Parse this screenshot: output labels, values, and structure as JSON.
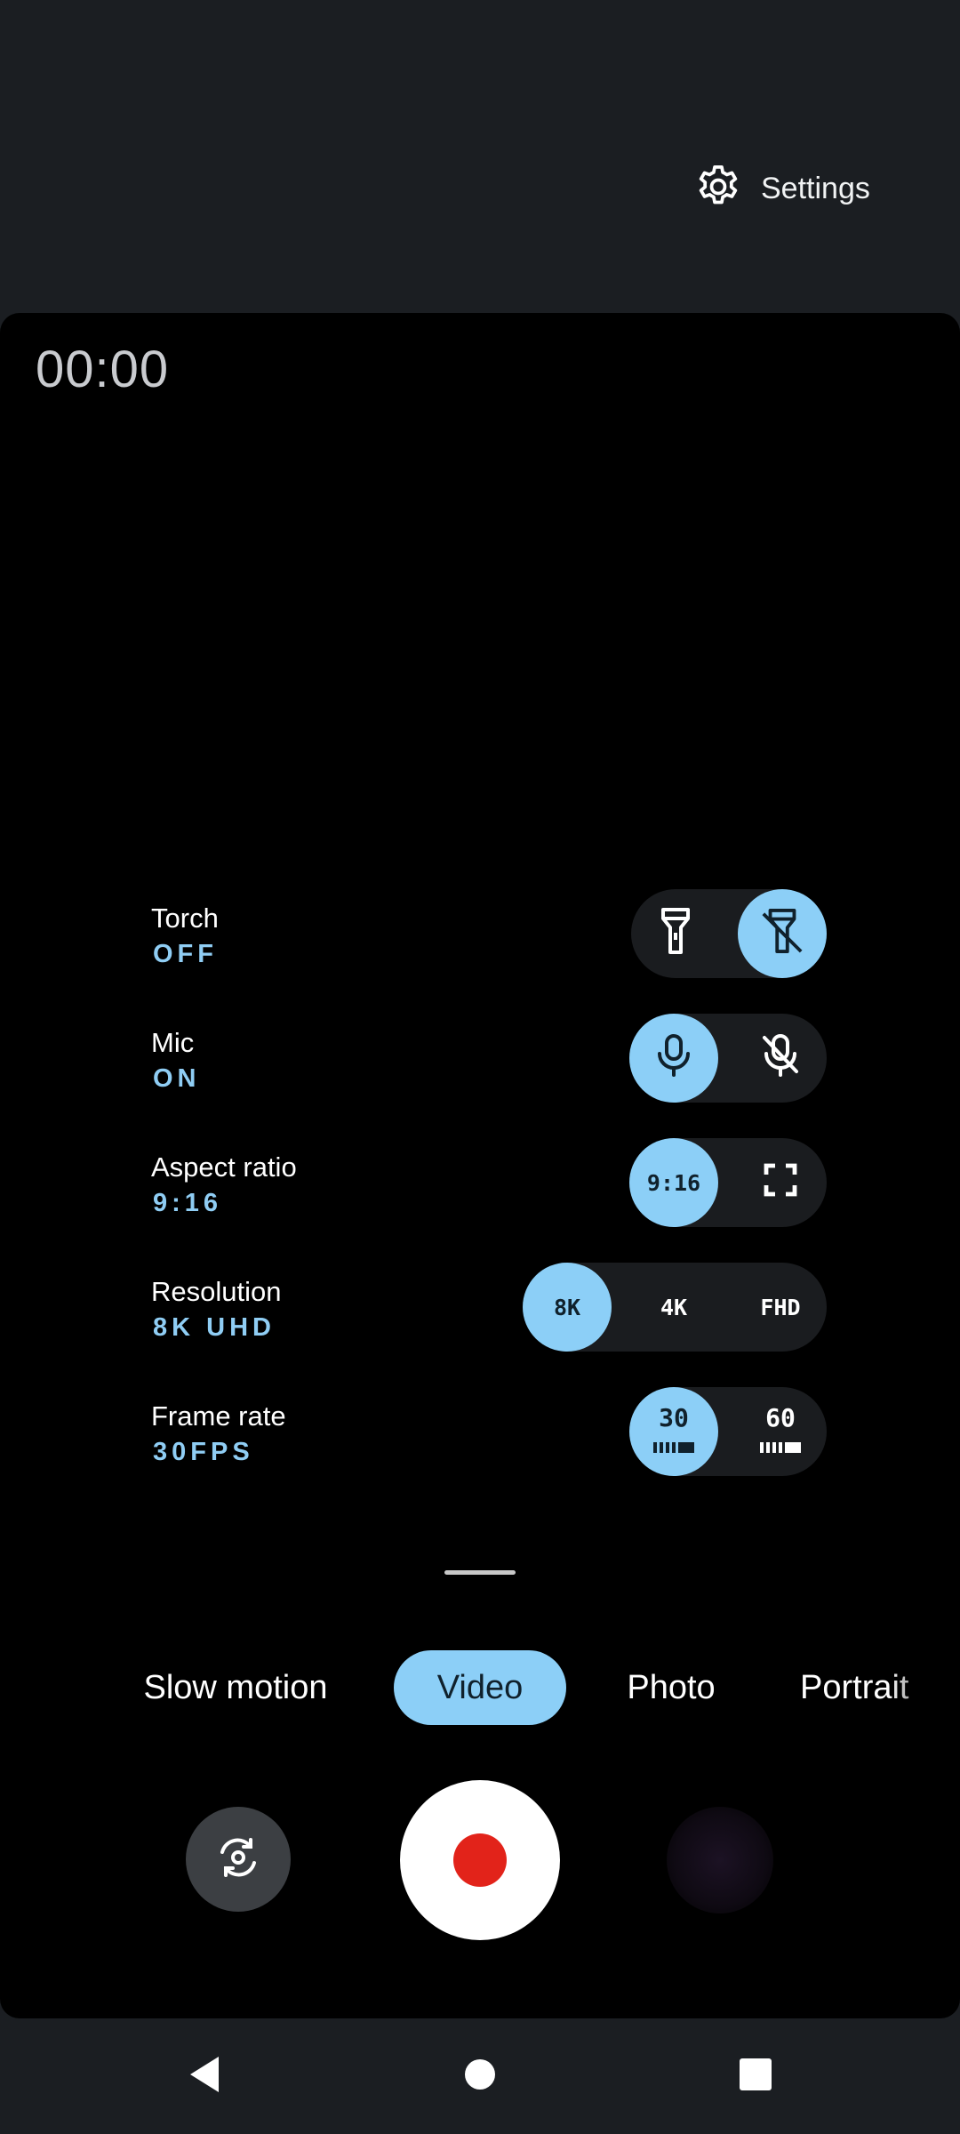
{
  "header": {
    "settings_label": "Settings",
    "settings_icon": "gear-icon"
  },
  "viewfinder": {
    "timer": "00:00"
  },
  "options": {
    "torch": {
      "label": "Torch",
      "value": "OFF",
      "choices": [
        "torch-on-icon",
        "torch-off-icon"
      ],
      "selected": "torch-off-icon"
    },
    "mic": {
      "label": "Mic",
      "value": "ON",
      "choices": [
        "mic-on-icon",
        "mic-off-icon"
      ],
      "selected": "mic-on-icon"
    },
    "aspect_ratio": {
      "label": "Aspect ratio",
      "value": "9:16",
      "choices": [
        "9:16",
        "fullscreen-icon"
      ],
      "selected": "9:16"
    },
    "resolution": {
      "label": "Resolution",
      "value": "8K UHD",
      "choices": [
        "8K",
        "4K",
        "FHD"
      ],
      "selected": "8K"
    },
    "frame_rate": {
      "label": "Frame rate",
      "value": "30FPS",
      "choices": [
        "30",
        "60"
      ],
      "selected": "30"
    }
  },
  "modes": {
    "items": [
      "Slow motion",
      "Video",
      "Photo",
      "Portrait"
    ],
    "selected": "Video"
  },
  "controls": {
    "flip_icon": "camera-flip-icon",
    "shutter_icon": "record-icon",
    "thumbnail": "gallery-thumbnail"
  },
  "nav": {
    "back": "back-icon",
    "home": "home-icon",
    "recents": "recents-icon"
  },
  "colors": {
    "accent": "#8ccff7",
    "value_text": "#8fcdf4",
    "record": "#e2231a",
    "background": "#1b1e22"
  }
}
